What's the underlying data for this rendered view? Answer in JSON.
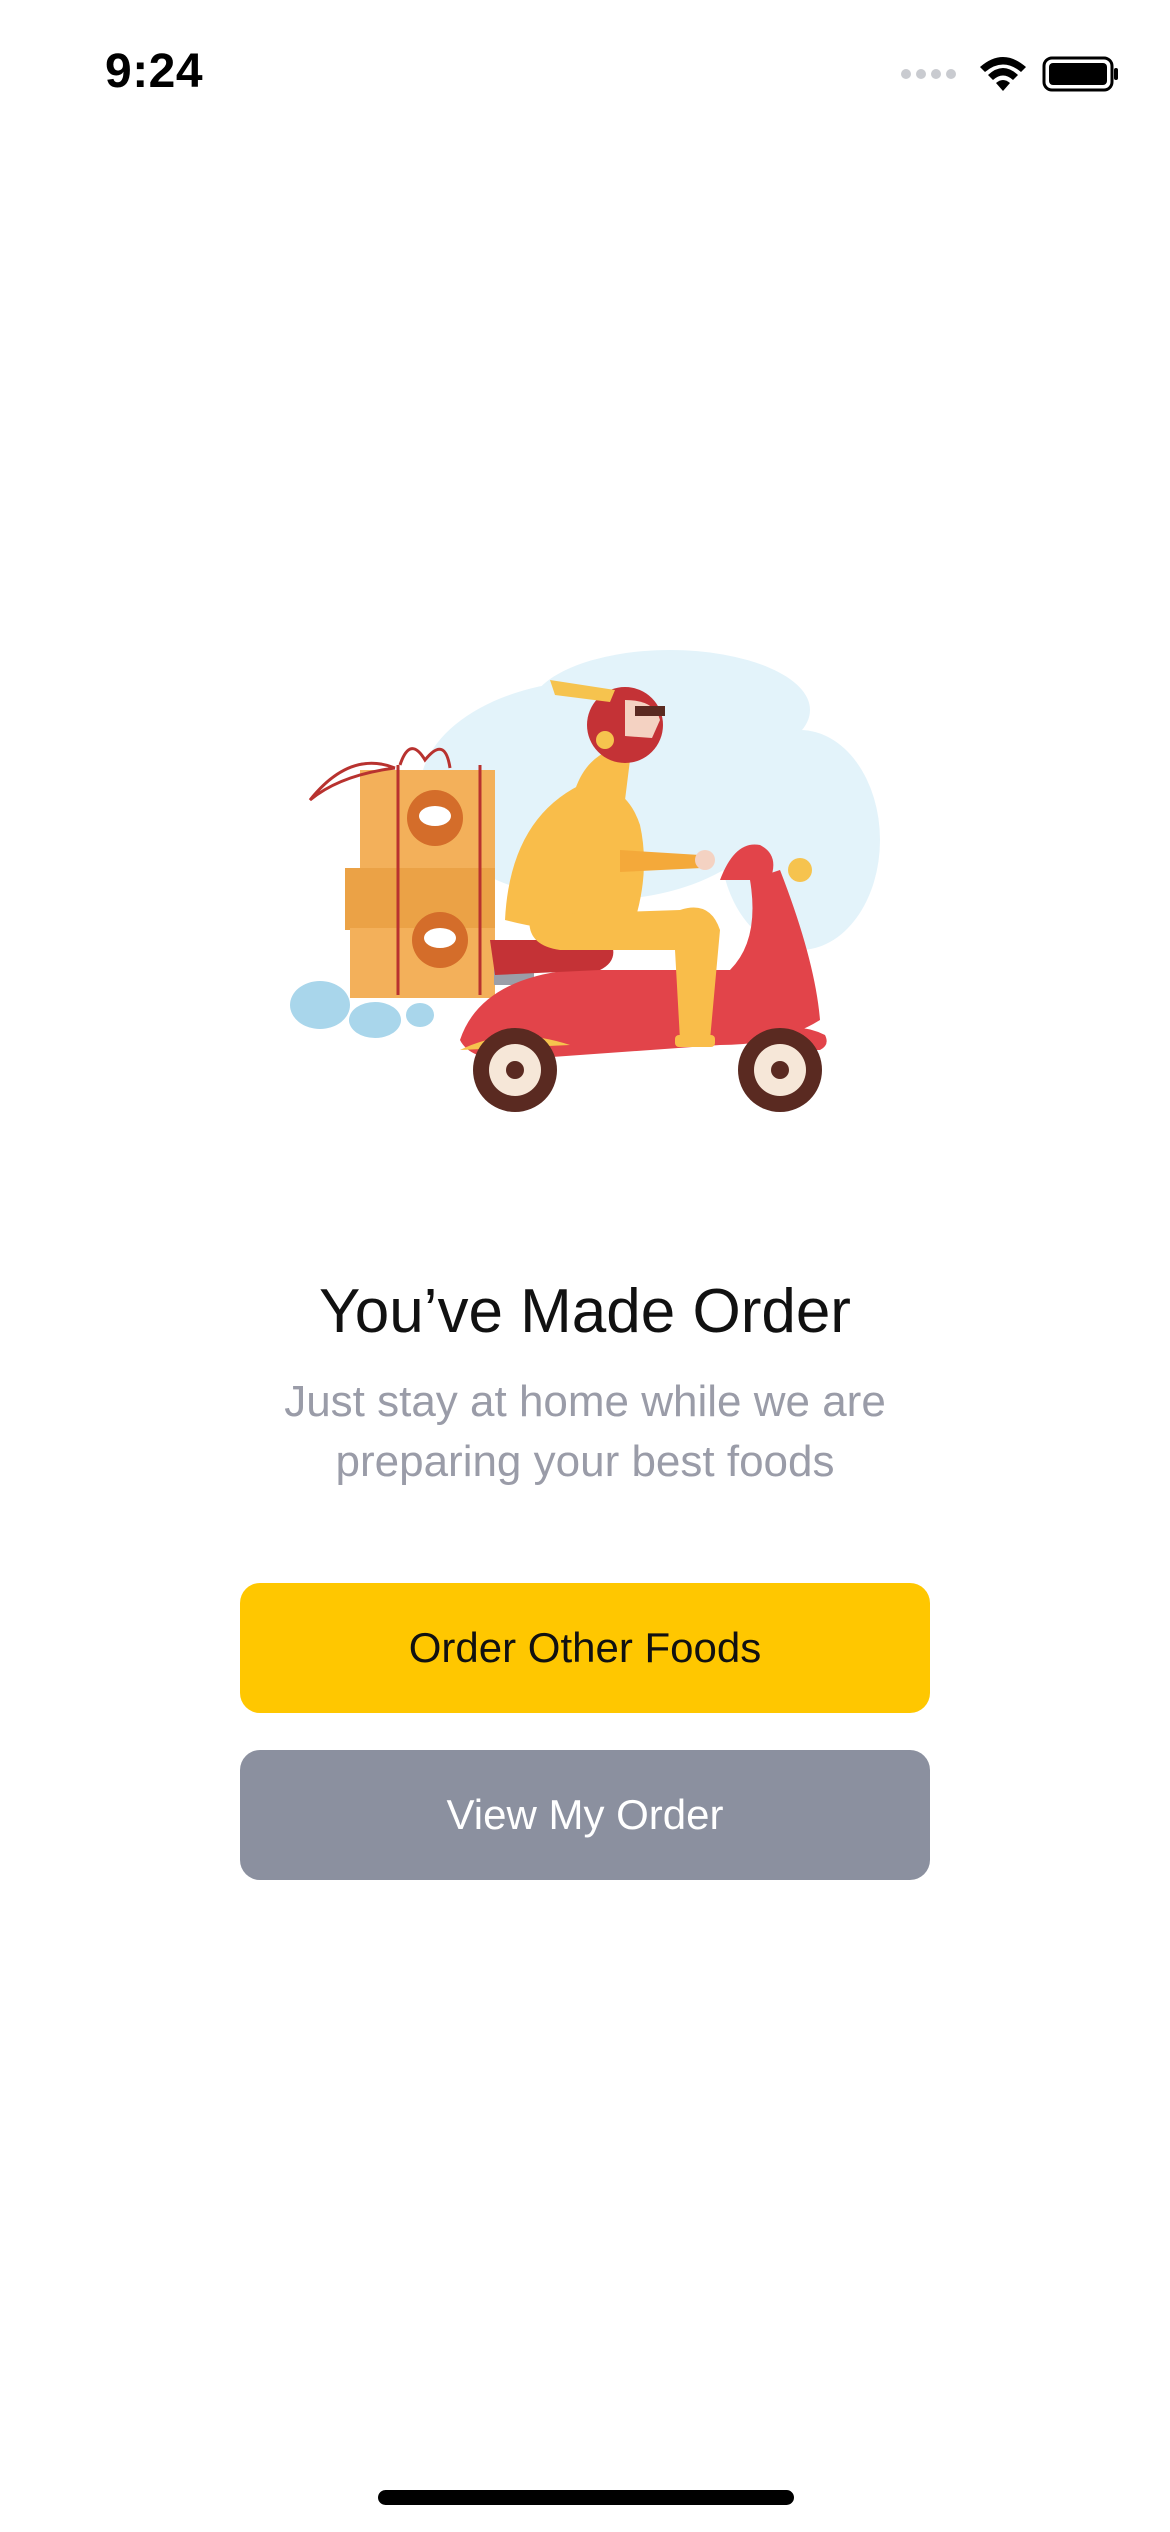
{
  "status_bar": {
    "time": "9:24"
  },
  "illustration": {
    "description_icon": "delivery-scooter-illustration"
  },
  "confirmation": {
    "title": "You’ve Made Order",
    "subtitle": "Just stay at home while we are preparing your best foods"
  },
  "actions": {
    "order_other_label": "Order Other Foods",
    "view_order_label": "View My Order"
  },
  "colors": {
    "primary": "#ffc700",
    "secondary": "#8b909f",
    "subtitle_text": "#9a9ca8"
  }
}
